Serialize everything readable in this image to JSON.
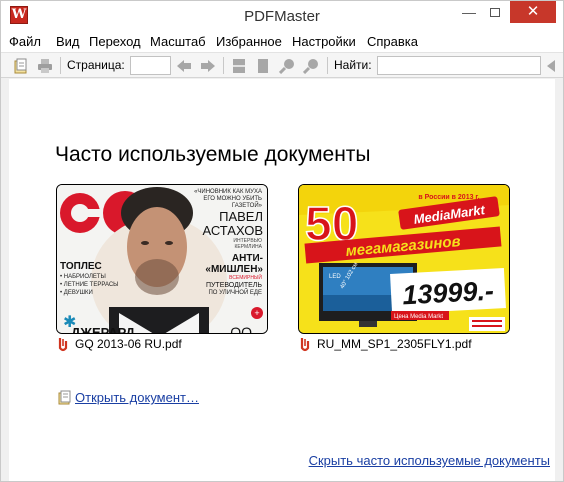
{
  "window": {
    "title": "PDFMaster",
    "app_icon_letter": "W",
    "minimize_glyph": "—",
    "close_glyph": "✕"
  },
  "menu": [
    "Файл",
    "Вид",
    "Переход",
    "Масштаб",
    "Избранное",
    "Настройки",
    "Справка"
  ],
  "toolbar": {
    "page_label": "Страница:",
    "page_value": "",
    "find_label": "Найти:",
    "find_value": ""
  },
  "main": {
    "heading": "Часто используемые документы",
    "documents": [
      {
        "filename": "GQ 2013-06 RU.pdf",
        "cover": {
          "masthead": "GQ",
          "lines": [
            "«ЧИНОВНИК КАК МУХА",
            "ЕГО МОЖНО УБИТЬ",
            "ГАЗЕТОЙ»",
            "ПАВЕЛ",
            "АСТАХОВ",
            "ИНТЕРВЬЮ",
            "КЕРМЛИНА",
            "АНТИ-",
            "«МИШЛЕН»",
            "ВСЕМИРНЫЙ",
            "ПУТЕВОДИТЕЛЬ",
            "ПО УЛИЧНОЙ ЕДЕ",
            "ТОПЛЕС",
            "• НАБРИОЛЕТЫ",
            "• ЛЕТНИЕ ТЕРРАСЫ",
            "• ДЕВУШКИ",
            "ДЖЕРАРД"
          ]
        }
      },
      {
        "filename": "RU_MM_SP1_2305FLY1.pdf",
        "cover": {
          "big_number": "50",
          "brand": "MediaMarkt",
          "banner": "мегамагазинов",
          "corner": "в России в 2013 г.",
          "price": "13999.-",
          "small": "Цена Media Markt",
          "led": "LED",
          "diag": "40\" 102 см"
        }
      }
    ],
    "open_document": "Открыть документ…",
    "hide_frequent": "Скрыть часто используемые документы"
  },
  "colors": {
    "link": "#1a3fa3",
    "close_button": "#c7372a",
    "gq_red": "#d9182b",
    "mm_yellow": "#f6e11a",
    "mm_red": "#d8141a"
  }
}
